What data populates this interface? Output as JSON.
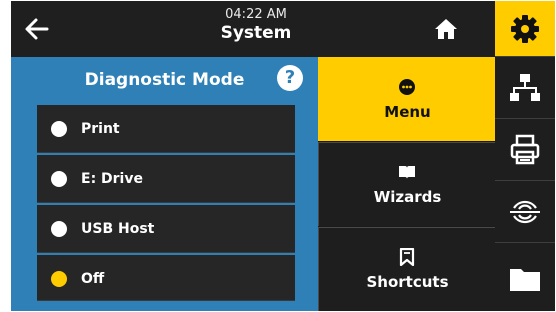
{
  "header": {
    "time": "04:22 AM",
    "title": "System",
    "back_icon": "arrow-left-icon",
    "home_icon": "home-icon"
  },
  "diagnostic_panel": {
    "title": "Diagnostic Mode",
    "help_label": "?",
    "options": [
      {
        "label": "Print",
        "selected": false
      },
      {
        "label": "E: Drive",
        "selected": false
      },
      {
        "label": "USB Host",
        "selected": false
      },
      {
        "label": "Off",
        "selected": true
      }
    ]
  },
  "nav": {
    "items": [
      {
        "label": "Menu",
        "icon": "menu-dots-icon",
        "active": true
      },
      {
        "label": "Wizards",
        "icon": "book-icon",
        "active": false
      },
      {
        "label": "Shortcuts",
        "icon": "bookmark-icon",
        "active": false
      }
    ]
  },
  "sidebar": {
    "items": [
      "gear-icon",
      "network-icon",
      "printer-icon",
      "rfid-icon",
      "folder-icon"
    ]
  },
  "colors": {
    "accent": "#ffcc00",
    "panel_blue": "#2f80b6",
    "background": "#1b1b1b"
  }
}
